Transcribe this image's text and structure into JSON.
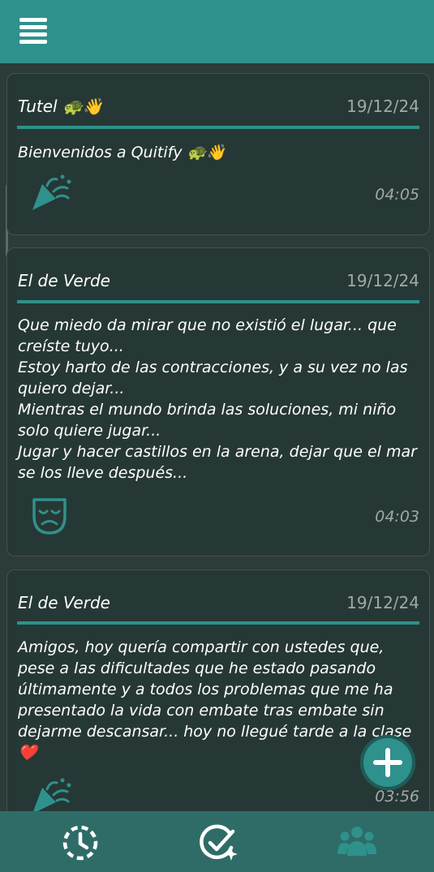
{
  "header": {
    "menu_icon": "hamburger-menu-icon"
  },
  "posts": [
    {
      "author": "Tutel 🐢👋",
      "date": "19/12/24",
      "lines": [
        "Bienvenidos a Quitify 🐢👋"
      ],
      "reaction_icon": "party-popper-icon",
      "time": "04:05"
    },
    {
      "author": "El de Verde",
      "date": "19/12/24",
      "lines": [
        "Que miedo da mirar que no existió el lugar... que",
        "creíste tuyo...",
        "Estoy harto de las contracciones, y a su vez no las",
        "quiero dejar...",
        "Mientras el mundo brinda las soluciones, mi niño",
        "solo quiere jugar...",
        "Jugar y hacer castillos en la arena, dejar que el mar",
        "se los lleve después..."
      ],
      "reaction_icon": "sad-mask-icon",
      "time": "04:03"
    },
    {
      "author": "El de Verde",
      "date": "19/12/24",
      "lines": [
        "Amigos, hoy quería compartir con ustedes que,",
        "pese a las dificultades que he estado pasando",
        "últimamente y a todos los problemas que me ha",
        "presentado la vida con embate tras embate sin",
        "dejarme descansar... hoy no llegué tarde a la clase",
        "❤️"
      ],
      "reaction_icon": "party-popper-icon",
      "time": "03:56"
    }
  ],
  "fab": {
    "icon": "plus-icon"
  },
  "bottom_nav": [
    {
      "icon": "history-clock-icon"
    },
    {
      "icon": "check-sparkle-icon"
    },
    {
      "icon": "community-group-icon"
    }
  ],
  "colors": {
    "accent": "#2f918c",
    "background": "#2c3c3a",
    "card": "#263836",
    "bottom_bar": "#2f6c67",
    "muted_text": "#a2a8a6"
  }
}
